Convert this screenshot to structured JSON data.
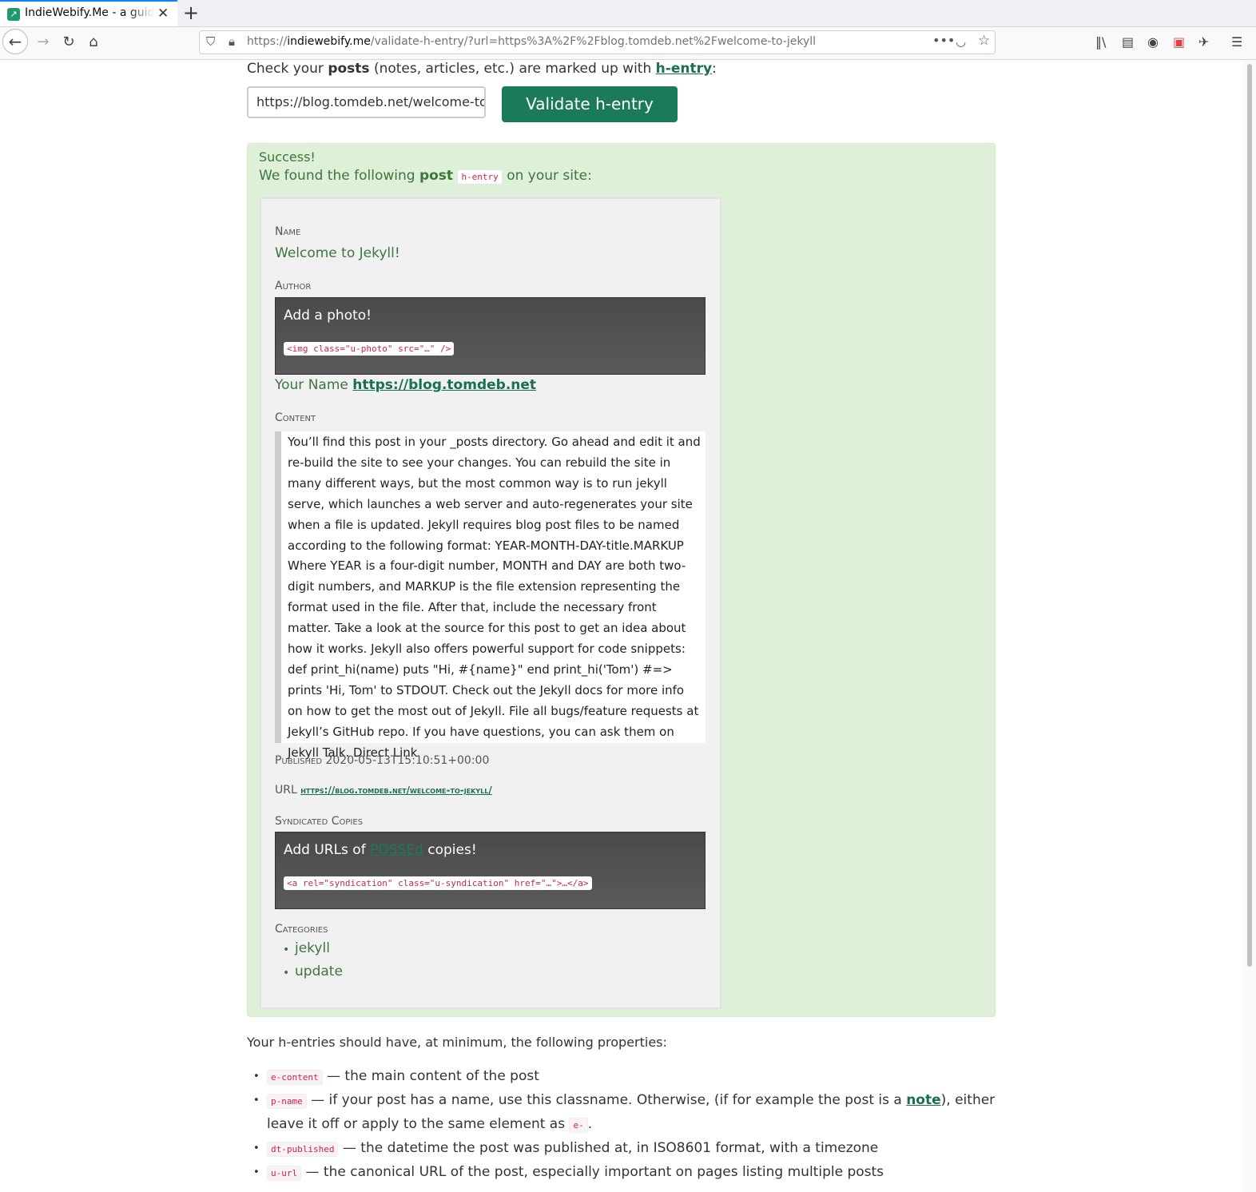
{
  "browser": {
    "tab_title": "IndieWebify.Me - a guide to getting you on the IndieWeb",
    "url_prefix": "https://",
    "url_domain": "indiewebify.me",
    "url_path": "/validate-h-entry/?url=https%3A%2F%2Fblog.tomdeb.net%2Fwelcome-to-jekyll",
    "icons": [
      "back-icon",
      "forward-icon",
      "reload-icon",
      "home-icon",
      "shield-icon",
      "lock-icon",
      "more-icon",
      "pocket-icon",
      "star-icon",
      "library-icon",
      "sidebar-icon",
      "account-icon",
      "extension-icon",
      "extension2-icon",
      "menu-icon"
    ]
  },
  "form": {
    "lead_pre": "Check your ",
    "lead_bold": "posts",
    "lead_mid": " (notes, articles, etc.) are marked up with ",
    "lead_link": "h-entry",
    "lead_post": ":",
    "input_value": "https://blog.tomdeb.net/welcome-to-jekyll",
    "button_label": "Validate h-entry"
  },
  "result": {
    "success_title": "Success!",
    "found_pre": "We found the following ",
    "found_bold": "post",
    "found_code": "h-entry",
    "found_post": " on your site:",
    "name_label": "Name",
    "name_value": "Welcome to Jekyll!",
    "author_label": "Author",
    "photo_prompt": "Add a photo!",
    "photo_code": "<img class=\"u-photo\" src=\"…\" />",
    "author_name": "Your Name",
    "author_url": "https://blog.tomdeb.net",
    "content_label": "Content",
    "content_text": "You’ll find this post in your _posts directory. Go ahead and edit it and re-build the site to see your changes. You can rebuild the site in many different ways, but the most common way is to run jekyll serve, which launches a web server and auto-regenerates your site when a file is updated. Jekyll requires blog post files to be named according to the following format: YEAR-MONTH-DAY-title.MARKUP Where YEAR is a four-digit number, MONTH and DAY are both two-digit numbers, and MARKUP is the file extension representing the format used in the file. After that, include the necessary front matter. Take a look at the source for this post to get an idea about how it works. Jekyll also offers powerful support for code snippets: def print_hi(name) puts \"Hi, #{name}\" end print_hi('Tom') #=> prints 'Hi, Tom' to STDOUT. Check out the Jekyll docs for more info on how to get the most out of Jekyll. File all bugs/feature requests at Jekyll’s GitHub repo. If you have questions, you can ask them on Jekyll Talk. Direct Link",
    "published_label": "Published",
    "published_value": "2020-05-13T15:10:51+00:00",
    "url_label": "URL",
    "url_value": "https://blog.tomdeb.net/welcome-to-jekyll/",
    "syndicated_label": "Syndicated Copies",
    "syndication_pre": "Add URLs of ",
    "syndication_link": "POSSEd",
    "syndication_post": " copies!",
    "syndication_code": "<a rel=\"syndication\" class=\"u-syndication\" href=\"…\">…</a>",
    "categories_label": "Categories",
    "categories": [
      "jekyll",
      "update"
    ]
  },
  "properties": {
    "intro": "Your h-entries should have, at minimum, the following properties:",
    "items": [
      {
        "code": "e-content",
        "text": " — the main content of the post"
      },
      {
        "code": "p-name",
        "text": " — if your post has a name, use this classname. Otherwise, (if for example the post is a ",
        "link": "note",
        "text2": "), either leave it off or apply to the same element as ",
        "code2": "e-",
        "text3": "."
      },
      {
        "code": "dt-published",
        "text": " — the datetime the post was published at, in ISO8601 format, with a timezone"
      },
      {
        "code": "u-url",
        "text": " — the canonical URL of the post, especially important on pages listing multiple posts"
      }
    ]
  }
}
